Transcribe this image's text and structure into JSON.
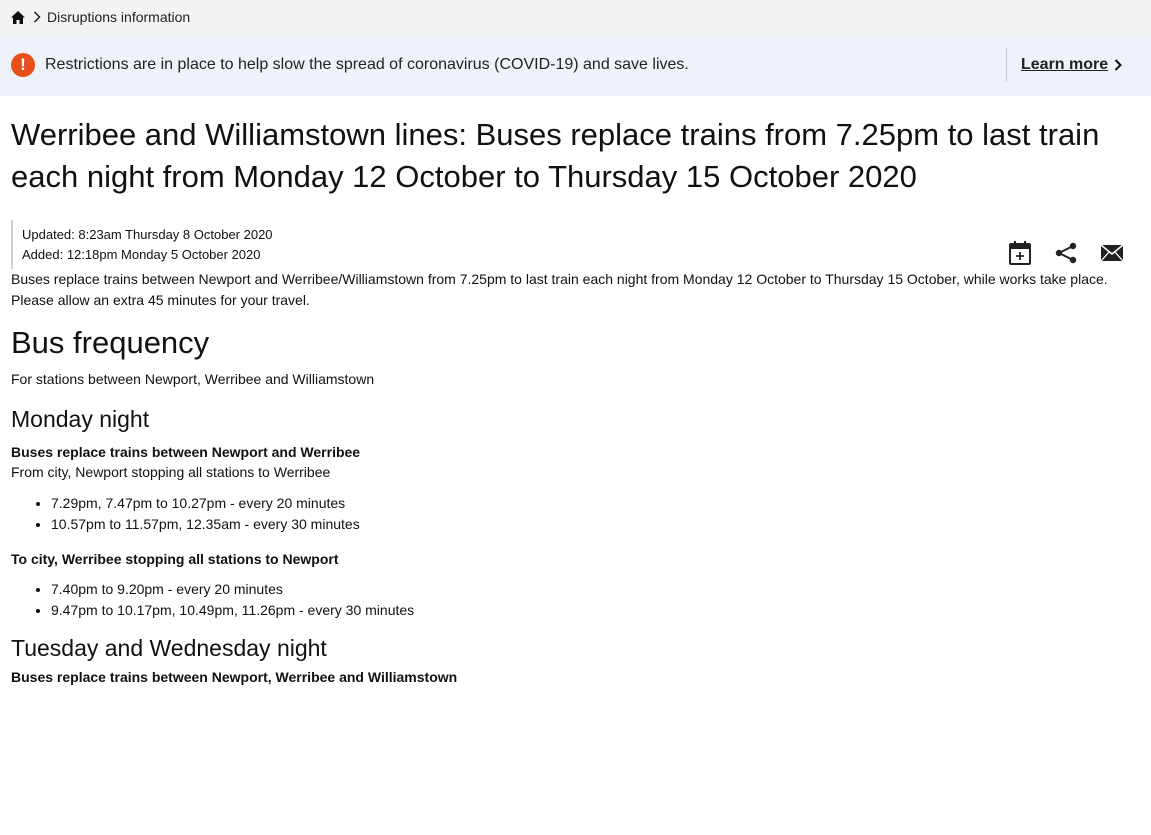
{
  "breadcrumb": {
    "current": "Disruptions information"
  },
  "alert": {
    "text": "Restrictions are in place to help slow the spread of coronavirus (COVID-19) and save lives.",
    "link": "Learn more",
    "icon_symbol": "!",
    "icon_color": "#e8501b"
  },
  "title": "Werribee and Williamstown lines: Buses replace trains from 7.25pm to last train each night from Monday 12 October to Thursday 15 October 2020",
  "meta": {
    "updated": "Updated: 8:23am Thursday 8 October 2020",
    "added": "Added: 12:18pm Monday 5 October 2020"
  },
  "actions": [
    "calendar-add-icon",
    "share-icon",
    "email-icon"
  ],
  "intro": "Buses replace trains between Newport and Werribee/Williamstown from 7.25pm to last train each night from Monday 12 October to Thursday 15 October, while works take place.",
  "allow": "Please allow an extra 45 minutes for your travel.",
  "bus_frequency": {
    "heading": "Bus frequency",
    "subtitle": "For stations between Newport, Werribee and Williamstown"
  },
  "monday": {
    "heading": "Monday night",
    "bold": "Buses replace trains between Newport and Werribee",
    "from_city": "From city, Newport stopping all stations to Werribee",
    "from_times": [
      "7.29pm, 7.47pm to 10.27pm - every  20 minutes",
      "10.57pm to 11.57pm, 12.35am - every 30 minutes"
    ],
    "to_city": "To city, Werribee stopping all stations to Newport",
    "to_times": [
      "7.40pm to 9.20pm - every 20 minutes",
      "9.47pm to 10.17pm, 10.49pm, 11.26pm - every 30 minutes"
    ]
  },
  "tuesday": {
    "heading": "Tuesday and Wednesday night",
    "bold": "Buses replace trains between Newport, Werribee and Williamstown"
  }
}
